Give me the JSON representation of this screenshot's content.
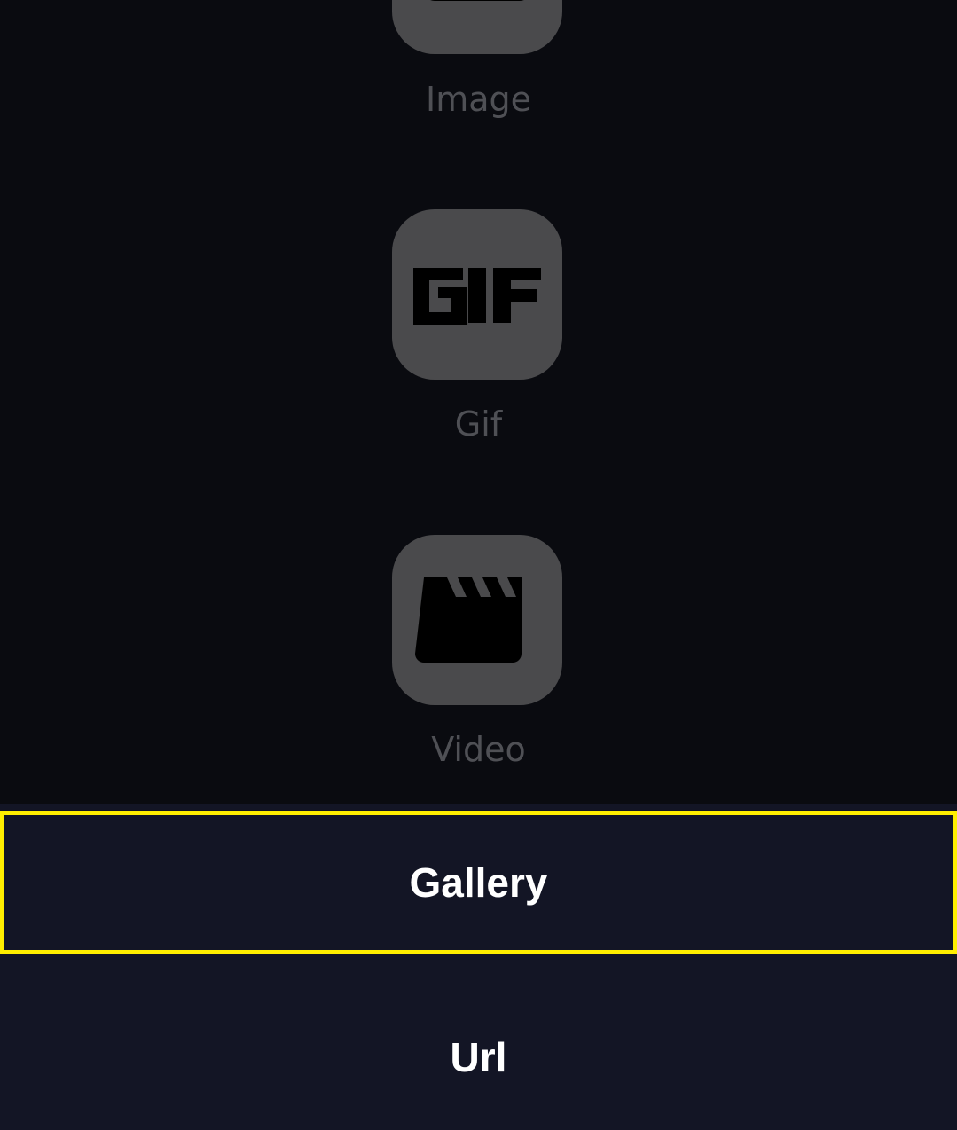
{
  "media_options": [
    {
      "label": "Image",
      "icon": "image-icon"
    },
    {
      "label": "Gif",
      "icon": "gif-icon",
      "icon_text": "GIF"
    },
    {
      "label": "Video",
      "icon": "clapperboard-icon"
    }
  ],
  "sheet": {
    "gallery_label": "Gallery",
    "url_label": "Url"
  },
  "colors": {
    "background": "#0a0b10",
    "tile": "#4a4a4c",
    "label": "#4f5055",
    "sheet": "#131525",
    "focus_outline": "#ffee00"
  }
}
